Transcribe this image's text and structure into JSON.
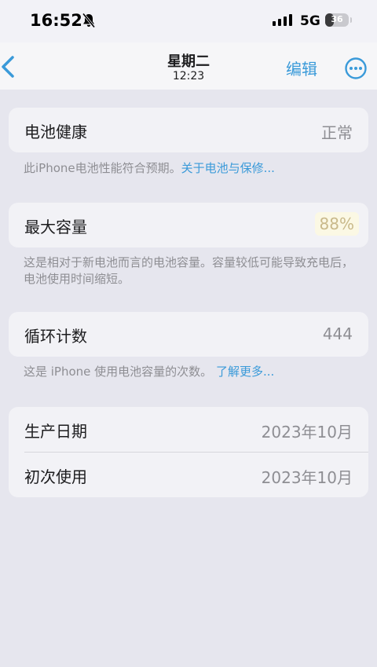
{
  "status_bar": {
    "time": "16:52",
    "network": "5G",
    "battery_text": "36",
    "battery_level": 0.36,
    "bell_icon": "bell-slash-icon",
    "signal_icon": "cellular-signal-icon"
  },
  "nav": {
    "back_icon": "chevron-left-icon",
    "title": "星期二",
    "subtitle": "12:23",
    "edit_label": "编辑",
    "more_icon": "ellipsis-circle-icon"
  },
  "battery_health": {
    "label": "电池健康",
    "value": "正常",
    "footnote_text": "此iPhone电池性能符合预期。",
    "footnote_link": "关于电池与保修..."
  },
  "max_capacity": {
    "label": "最大容量",
    "value": "88%",
    "footnote_text": "这是相对于新电池而言的电池容量。容量较低可能导致充电后，电池使用时间缩短。"
  },
  "cycle_count": {
    "label": "循环计数",
    "value": "444",
    "footnote_text": "这是 iPhone 使用电池容量的次数。",
    "footnote_link": "了解更多..."
  },
  "dates": {
    "manufacture_label": "生产日期",
    "manufacture_value": "2023年10月",
    "first_use_label": "初次使用",
    "first_use_value": "2023年10月"
  },
  "colors": {
    "accent": "#3a9ad9",
    "background": "#e6e6ee",
    "card": "#f2f2f6",
    "secondary_text": "#8e8e93"
  }
}
